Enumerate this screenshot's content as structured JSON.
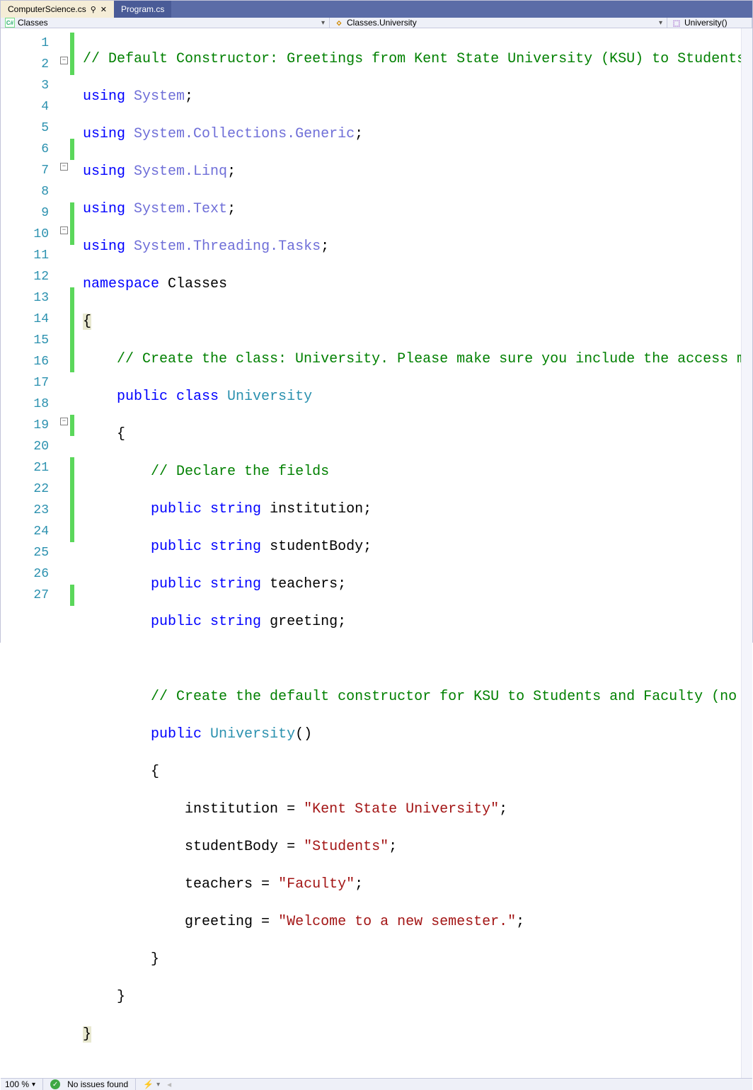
{
  "tabs": {
    "active": "ComputerScience.cs",
    "inactive": "Program.cs"
  },
  "nav": {
    "project": "Classes",
    "scope": "Classes.University",
    "member": "University()"
  },
  "lines": {
    "l1": {
      "n": "1"
    },
    "l2": {
      "n": "2"
    },
    "l3": {
      "n": "3"
    },
    "l4": {
      "n": "4"
    },
    "l5": {
      "n": "5"
    },
    "l6": {
      "n": "6"
    },
    "l7": {
      "n": "7"
    },
    "l8": {
      "n": "8"
    },
    "l9": {
      "n": "9"
    },
    "l10": {
      "n": "10"
    },
    "l11": {
      "n": "11"
    },
    "l12": {
      "n": "12"
    },
    "l13": {
      "n": "13"
    },
    "l14": {
      "n": "14"
    },
    "l15": {
      "n": "15"
    },
    "l16": {
      "n": "16"
    },
    "l17": {
      "n": "17"
    },
    "l18": {
      "n": "18"
    },
    "l19": {
      "n": "19"
    },
    "l20": {
      "n": "20"
    },
    "l21": {
      "n": "21"
    },
    "l22": {
      "n": "22"
    },
    "l23": {
      "n": "23"
    },
    "l24": {
      "n": "24"
    },
    "l25": {
      "n": "25"
    },
    "l26": {
      "n": "26"
    },
    "l27": {
      "n": "27"
    }
  },
  "code": {
    "c1_cm": "// Default Constructor: Greetings from Kent State University (KSU) to Students and Faculty",
    "c2_using": "using",
    "c2_ns": " System",
    "c3_using": "using",
    "c3_ns": " System.Collections.Generic",
    "c4_using": "using",
    "c4_ns": " System.Linq",
    "c5_using": "using",
    "c5_ns": " System.Text",
    "c6_using": "using",
    "c6_ns": " System.Threading.Tasks",
    "c7_ns_kw": "namespace",
    "c7_ns_name": " Classes",
    "c8_brace": "{",
    "c9_cm": "// Create the class: University. Please make sure you include the access modifier",
    "c10_pub": "public",
    "c10_class": " class",
    "c10_type": " University",
    "c11_brace": "{",
    "c12_cm": "// Declare the fields",
    "c13_pub": "public",
    "c13_str": " string",
    "c13_id": " institution",
    "c14_pub": "public",
    "c14_str": " string",
    "c14_id": " studentBody",
    "c15_pub": "public",
    "c15_str": " string",
    "c15_id": " teachers",
    "c16_pub": "public",
    "c16_str": " string",
    "c16_id": " greeting",
    "c18_cm": "// Create the default constructor for KSU to Students and Faculty (no parameters)",
    "c19_pub": "public",
    "c19_ctor": " University",
    "c20_brace": "{",
    "c21_id": "institution",
    "c21_val": "\"Kent State University\"",
    "c22_id": "studentBody",
    "c22_val": "\"Students\"",
    "c23_id": "teachers",
    "c23_val": "\"Faculty\"",
    "c24_id": "greeting",
    "c24_val": "\"Welcome to a new semester.\"",
    "c25_brace": "}",
    "c26_brace": "}",
    "c27_brace": "}",
    "semi": ";",
    "parens": "()",
    "eq": " = "
  },
  "status": {
    "zoom": "100 %",
    "issues": "No issues found"
  }
}
